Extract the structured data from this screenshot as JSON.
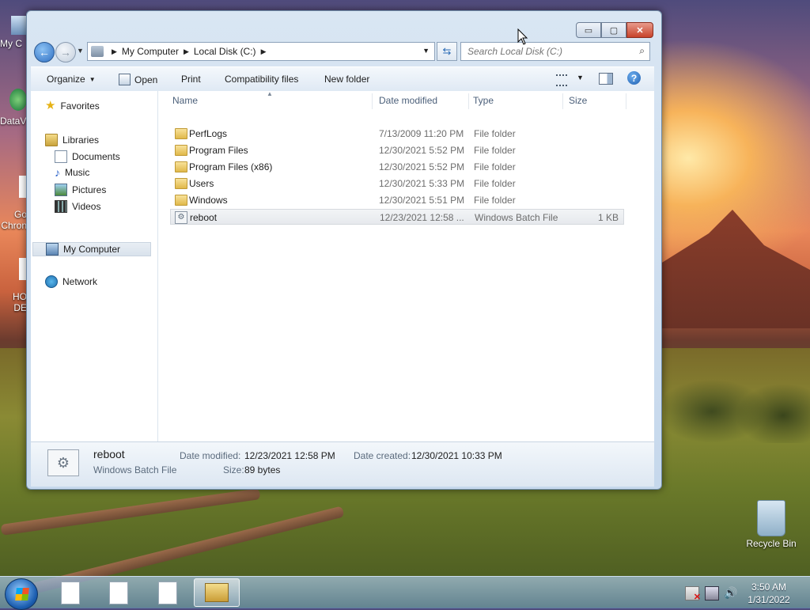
{
  "desktop": {
    "left_icons": [
      {
        "label": "My C"
      },
      {
        "label": "DataV"
      },
      {
        "label": "Go Chron"
      },
      {
        "label": "HO DE"
      }
    ],
    "recycle_bin_label": "Recycle Bin"
  },
  "window": {
    "caption_buttons": {
      "minimize": "▭",
      "maximize": "▢",
      "close": "✕"
    },
    "address": {
      "crumbs": [
        "My Computer",
        "Local Disk (C:)"
      ]
    },
    "search": {
      "placeholder": "Search Local Disk (C:)"
    },
    "toolbar": {
      "organize": "Organize",
      "open": "Open",
      "print": "Print",
      "compatibility": "Compatibility files",
      "new_folder": "New folder"
    },
    "nav_pane": {
      "favorites": "Favorites",
      "libraries": "Libraries",
      "documents": "Documents",
      "music": "Music",
      "pictures": "Pictures",
      "videos": "Videos",
      "my_computer": "My Computer",
      "network": "Network"
    },
    "columns": {
      "name": "Name",
      "date": "Date modified",
      "type": "Type",
      "size": "Size"
    },
    "files": [
      {
        "name": "PerfLogs",
        "date": "7/13/2009 11:20 PM",
        "type": "File folder",
        "size": ""
      },
      {
        "name": "Program Files",
        "date": "12/30/2021 5:52 PM",
        "type": "File folder",
        "size": ""
      },
      {
        "name": "Program Files (x86)",
        "date": "12/30/2021 5:52 PM",
        "type": "File folder",
        "size": ""
      },
      {
        "name": "Users",
        "date": "12/30/2021 5:33 PM",
        "type": "File folder",
        "size": ""
      },
      {
        "name": "Windows",
        "date": "12/30/2021 5:51 PM",
        "type": "File folder",
        "size": ""
      },
      {
        "name": "reboot",
        "date": "12/23/2021 12:58 ...",
        "type": "Windows Batch File",
        "size": "1 KB"
      }
    ],
    "details": {
      "name": "reboot",
      "type": "Windows Batch File",
      "date_modified_label": "Date modified:",
      "date_modified": "12/23/2021 12:58 PM",
      "date_created_label": "Date created:",
      "date_created": "12/30/2021 10:33 PM",
      "size_label": "Size:",
      "size": "89 bytes"
    }
  },
  "taskbar": {
    "time": "3:50 AM",
    "date": "1/31/2022"
  },
  "colors": {
    "accent": "#2f6fc2",
    "selection": "#e6e9ed"
  }
}
